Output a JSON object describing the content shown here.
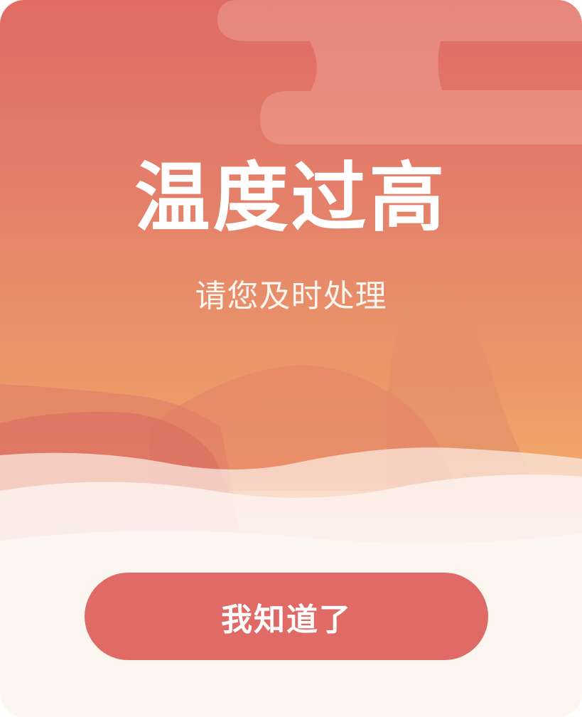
{
  "alert": {
    "title": "温度过高",
    "message": "请您及时处理",
    "confirm_label": "我知道了"
  },
  "colors": {
    "top_gradient": "#e06b62",
    "bottom_gradient": "#fcf6f2",
    "button": "#df6a66",
    "text": "#ffffff"
  }
}
